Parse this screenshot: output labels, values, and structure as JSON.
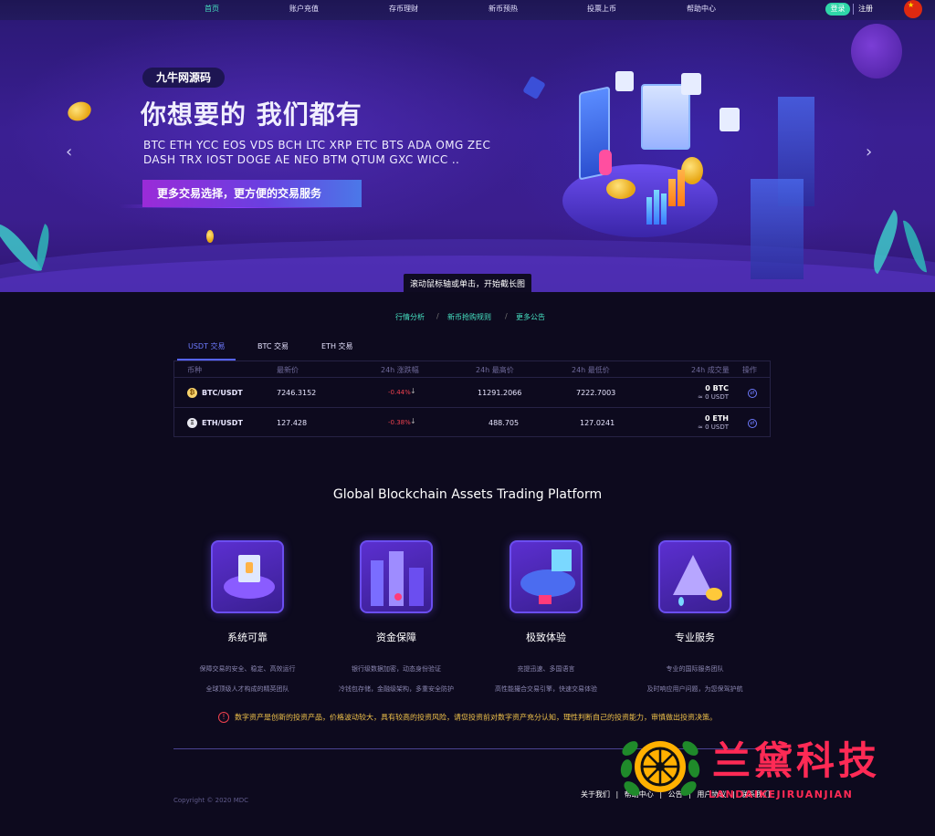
{
  "nav": {
    "items": [
      {
        "label": "首页"
      },
      {
        "label": "账户充值"
      },
      {
        "label": "存币理财"
      },
      {
        "label": "新币预热"
      },
      {
        "label": "投票上币"
      },
      {
        "label": "帮助中心"
      }
    ],
    "login_label": "登录",
    "register_label": "注册",
    "flag_icon": "china-flag-icon"
  },
  "banner": {
    "brand": "九牛网源码",
    "headline": "你想要的 我们都有",
    "coins_line1": "BTC ETH YCC EOS VDS BCH LTC XRP ETC BTS ADA OMG ZEC",
    "coins_line2": "DASH TRX IOST DOGE AE NEO BTM QTUM GXC WICC ..",
    "cta": "更多交易选择，更方便的交易服务",
    "tooltip": "滚动鼠标轴或单击，开始截长图",
    "prev_arrow": "‹",
    "next_arrow": "›"
  },
  "notices": [
    {
      "label": "行情分析"
    },
    {
      "label": "新币抢购规则"
    },
    {
      "label": "更多公告"
    }
  ],
  "notice_sep": "/",
  "market": {
    "tabs": [
      {
        "label": "USDT 交易"
      },
      {
        "label": "BTC 交易"
      },
      {
        "label": "ETH 交易"
      }
    ],
    "columns": {
      "coin": "币种",
      "price": "最新价",
      "change": "24h 涨跌幅",
      "high": "24h 最高价",
      "low": "24h 最低价",
      "volume": "24h 成交量",
      "action": "操作"
    },
    "rows": [
      {
        "icon": "₿",
        "pair": "BTC/USDT",
        "price": "7246.3152",
        "change": "-0.44%",
        "high": "11291.2066",
        "low": "7222.7003",
        "vol_main": "0 BTC",
        "vol_sub": "≈ 0 USDT"
      },
      {
        "icon": "Ξ",
        "pair": "ETH/USDT",
        "price": "127.428",
        "change": "-0.38%",
        "high": "488.705",
        "low": "127.0241",
        "vol_main": "0 ETH",
        "vol_sub": "≈ 0 USDT"
      }
    ]
  },
  "platform": {
    "title": "Global Blockchain Assets Trading Platform",
    "features": [
      {
        "title": "系统可靠",
        "desc1": "保障交易的安全、稳定、高效运行",
        "desc2": "全球顶级人才构成的精英团队"
      },
      {
        "title": "资金保障",
        "desc1": "银行级数据加密，动态身份验证",
        "desc2": "冷钱包存储，金融级架构，多重安全防护"
      },
      {
        "title": "极致体验",
        "desc1": "充提迅速、多国语言",
        "desc2": "高性能撮合交易引擎，快速交易体验"
      },
      {
        "title": "专业服务",
        "desc1": "专业的国际服务团队",
        "desc2": "及时响应用户问题，为您保驾护航"
      }
    ]
  },
  "risk_notice": "数字资产是创新的投资产品，价格波动较大，具有较高的投资风险，请您投资前对数字资产充分认知，理性判断自己的投资能力，审慎做出投资决策。",
  "footer": {
    "copyright": "Copyright © 2020 MDC",
    "links": [
      "关于我们",
      "帮助中心",
      "公告",
      "用户协议",
      "联系我们"
    ],
    "sep": "|"
  },
  "watermark": {
    "text": "兰黛科技",
    "sub": "LANDAIKEJIRUANJIAN"
  },
  "colors": {
    "accent": "#46e0c1",
    "negative": "#f0414e",
    "tab_active": "#6e7bff",
    "background": "#0d0a1e"
  }
}
